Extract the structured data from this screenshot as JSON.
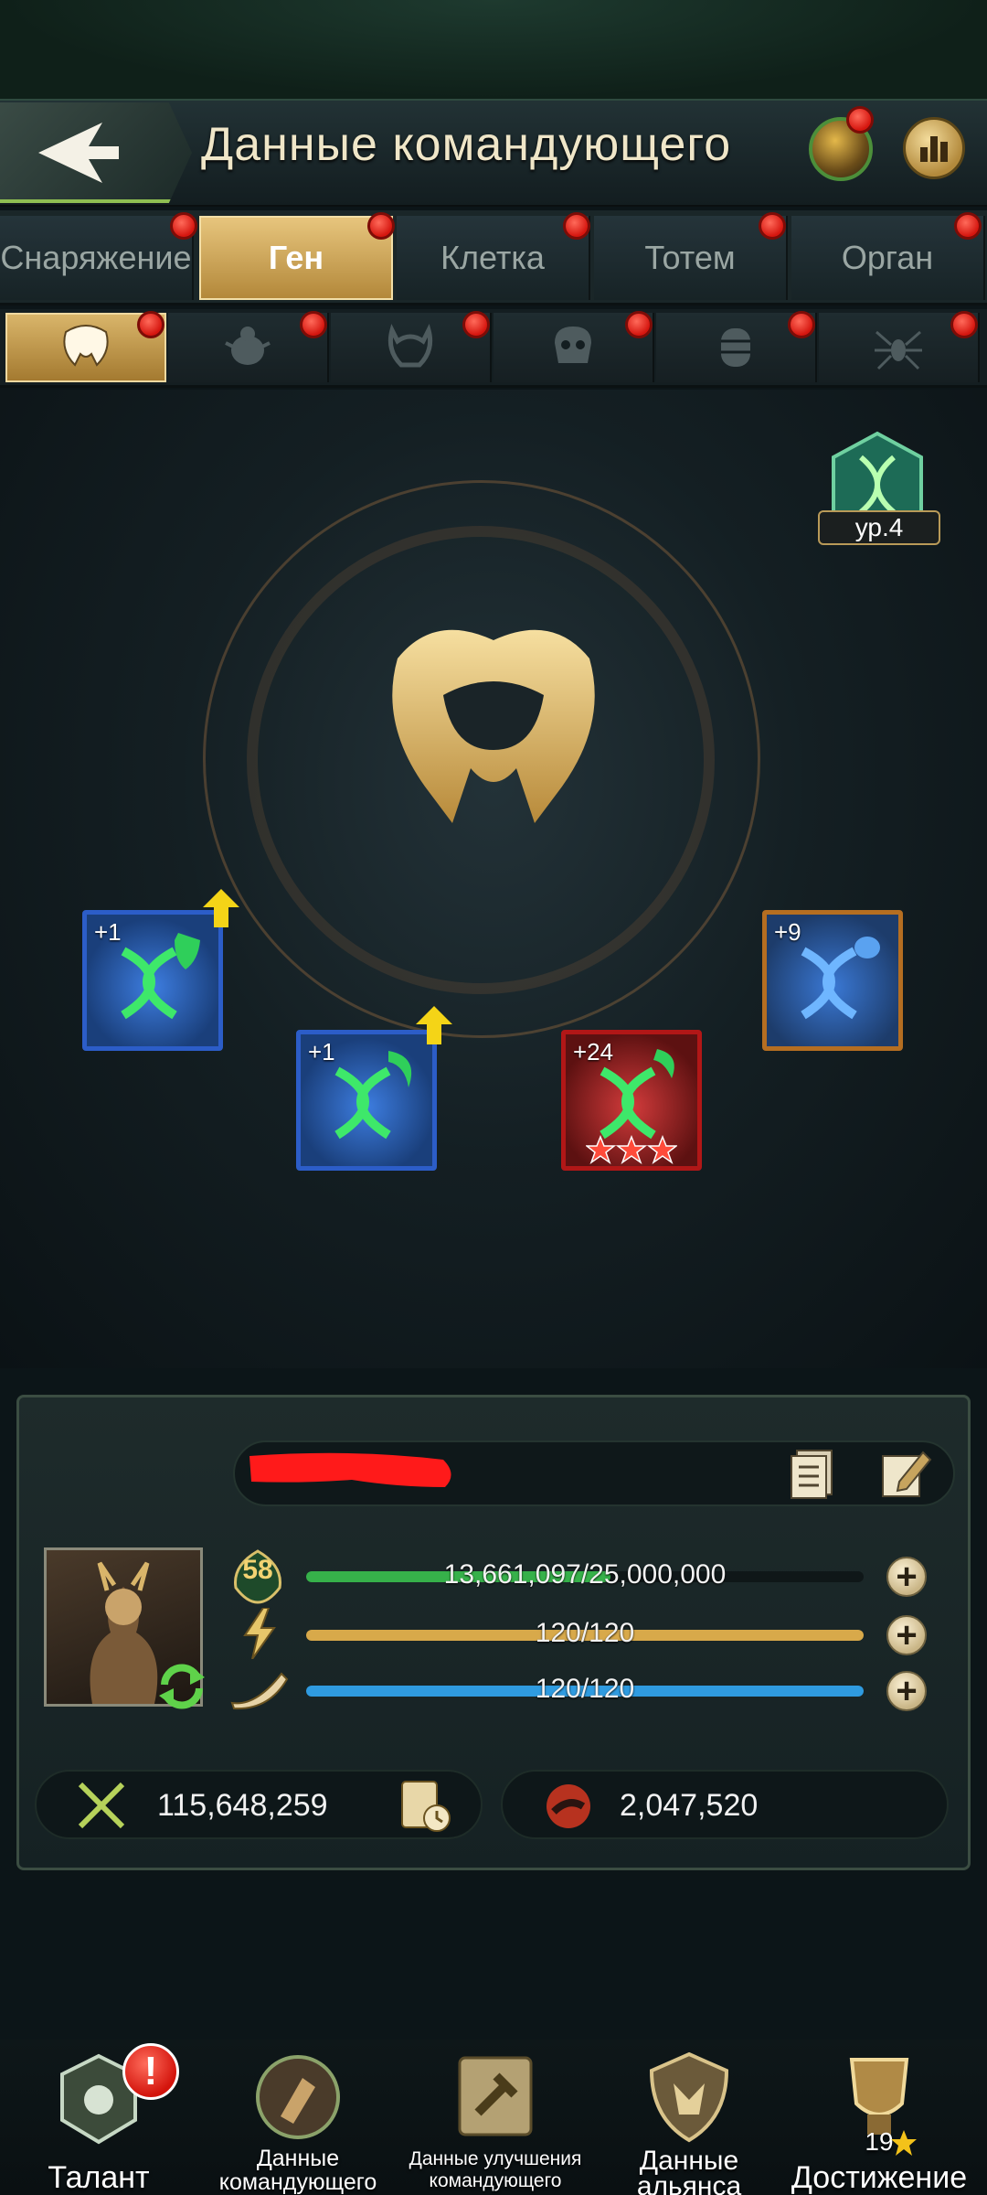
{
  "header": {
    "title": "Данные командующего"
  },
  "tabs": [
    {
      "label": "Снаряжение",
      "active": false,
      "badge": true
    },
    {
      "label": "Ген",
      "active": true,
      "badge": true
    },
    {
      "label": "Клетка",
      "active": false,
      "badge": true
    },
    {
      "label": "Тотем",
      "active": false,
      "badge": true
    },
    {
      "label": "Орган",
      "active": false,
      "badge": true
    }
  ],
  "subtabs": [
    {
      "icon": "horn-mask-icon",
      "active": true
    },
    {
      "icon": "beetle-icon",
      "active": false
    },
    {
      "icon": "claw-icon",
      "active": false
    },
    {
      "icon": "skull-icon",
      "active": false
    },
    {
      "icon": "larva-icon",
      "active": false
    },
    {
      "icon": "spider-icon",
      "active": false
    }
  ],
  "gene": {
    "level_label": "ур.4",
    "cards": [
      {
        "level": "+1",
        "rarity": "blue",
        "upgradable": true,
        "symbol": "shield"
      },
      {
        "level": "+1",
        "rarity": "blue",
        "upgradable": true,
        "symbol": "claw"
      },
      {
        "level": "+24",
        "rarity": "red",
        "upgradable": false,
        "symbol": "tail",
        "stars": 3
      },
      {
        "level": "+9",
        "rarity": "orange",
        "upgradable": false,
        "symbol": "ant"
      }
    ]
  },
  "commander": {
    "level": "58",
    "exp_text": "13,661,097/25,000,000",
    "exp_fraction": 0.546,
    "energy_text": "120/120",
    "energy_fraction": 1.0,
    "stamina_text": "120/120",
    "stamina_fraction": 1.0,
    "power": "115,648,259",
    "kills": "2,047,520"
  },
  "bottom_nav": {
    "talent": "Талант",
    "commander_data_1": "Данные",
    "commander_data_2": "командующего",
    "upgrade_data_1": "Данные улучшения",
    "upgrade_data_2": "командующего",
    "alliance_data_1": "Данные",
    "alliance_data_2": "альянса",
    "achievement": "Достижение",
    "achievement_count": "19"
  },
  "colors": {
    "exp_bar": "#36b14a",
    "energy_bar": "#d8a94a",
    "stamina_bar": "#2f9be0",
    "badge_red": "#d5160f",
    "gold": "#d9b56a"
  }
}
